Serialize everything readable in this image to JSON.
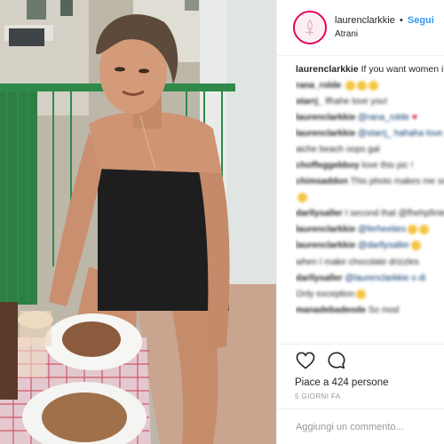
{
  "post": {
    "username": "laurenclarkkie",
    "follow_label": "Segui",
    "location": "Atrani",
    "caption_user": "laurenclarkkie",
    "caption_text": "If you want women in the kitchen JOKES ON U I can't cook"
  },
  "comments": [
    {
      "user": "rana_rolde",
      "text": "",
      "emoji": 3
    },
    {
      "user": "starrj_",
      "text": "lfhahe love you!",
      "emoji": 0
    },
    {
      "user": "laurenclarkkie",
      "text": "@rana_rolde",
      "emoji": 0,
      "heart": true
    },
    {
      "user": "laurenclarkkie",
      "text": "@starrj_ hahaha love you",
      "emoji": 0
    },
    {
      "user": "",
      "text": "aiche beach oops gal",
      "emoji": 0
    },
    {
      "user": "choffeggebboy",
      "text": "love this pic !",
      "emoji": 0
    },
    {
      "user": "chimsaddon",
      "text": "This photo makes me smile",
      "emoji": 0
    },
    {
      "user": "",
      "text": "",
      "emoji": 1
    },
    {
      "user": "darllysaller",
      "text": "I second that @fhehpfinterio",
      "emoji": 0
    },
    {
      "user": "laurenclarkkie",
      "text": "@ferheeties",
      "emoji": 2
    },
    {
      "user": "laurenclarkkie",
      "text": "@darllysaller",
      "emoji": 1
    },
    {
      "user": "",
      "text": "when I make chocolate drizzles",
      "emoji": 0
    },
    {
      "user": "darllysaller",
      "text": "@laurenclarkkie o di",
      "emoji": 0
    },
    {
      "user": "",
      "text": "Only exception",
      "emoji": 1
    },
    {
      "user": "manadebadeode",
      "text": "So mod",
      "emoji": 0
    }
  ],
  "actions": {
    "likes_text": "Piace a 424 persone",
    "time_ago": "5 GIORNI FA"
  },
  "comment_input": {
    "placeholder": "Aggiungi un commento..."
  },
  "icons": {
    "like": "heart-outline-icon",
    "comment": "speech-bubble-icon"
  },
  "colors": {
    "follow": "#3897f0",
    "avatar_ring": "#e6005c",
    "muted": "#999999"
  }
}
